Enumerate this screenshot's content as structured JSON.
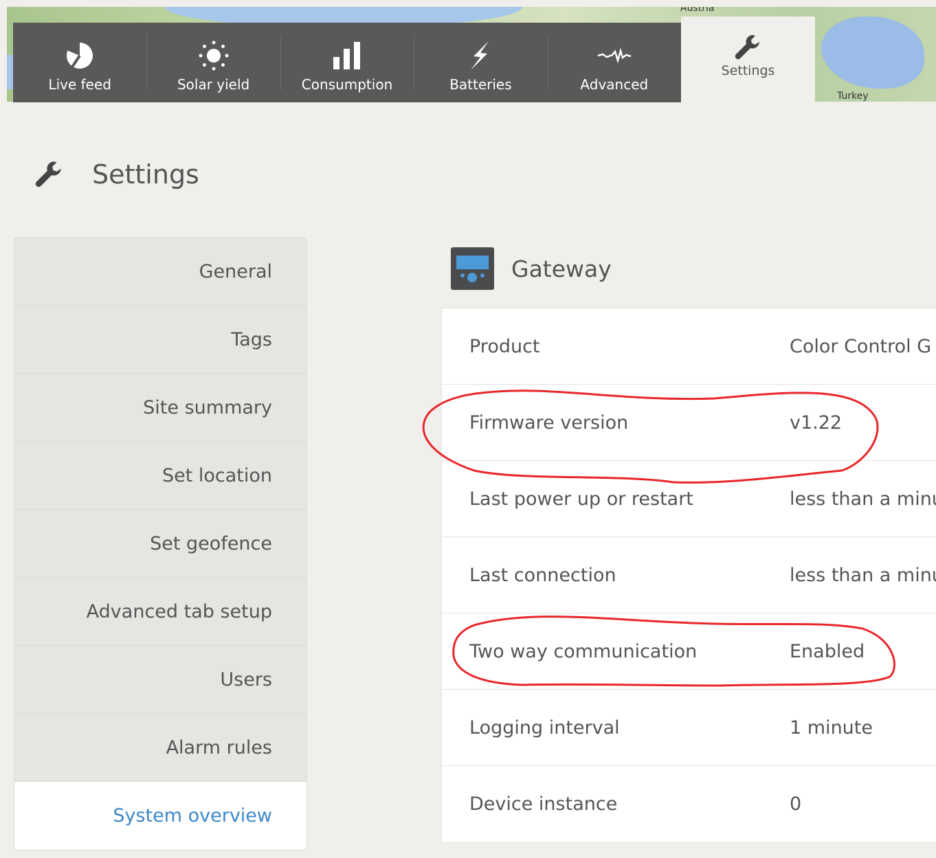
{
  "map": {
    "labels": {
      "austria": "Austria",
      "turkey": "Turkey"
    }
  },
  "nav": {
    "tabs": [
      {
        "label": "Live feed",
        "icon": "pie-chart-icon"
      },
      {
        "label": "Solar yield",
        "icon": "sun-icon"
      },
      {
        "label": "Consumption",
        "icon": "bar-chart-icon"
      },
      {
        "label": "Batteries",
        "icon": "lightning-icon"
      },
      {
        "label": "Advanced",
        "icon": "waveform-icon"
      }
    ],
    "settings_tab": {
      "label": "Settings",
      "icon": "wrench-icon"
    }
  },
  "page": {
    "title": "Settings",
    "icon": "wrench-icon"
  },
  "sidebar": {
    "items": [
      {
        "label": "General"
      },
      {
        "label": "Tags"
      },
      {
        "label": "Site summary"
      },
      {
        "label": "Set location"
      },
      {
        "label": "Set geofence"
      },
      {
        "label": "Advanced tab setup"
      },
      {
        "label": "Users"
      },
      {
        "label": "Alarm rules"
      },
      {
        "label": "System overview",
        "active": true
      }
    ]
  },
  "gateway": {
    "title": "Gateway",
    "icon": "device-icon",
    "rows": [
      {
        "key": "Product",
        "value": "Color Control G"
      },
      {
        "key": "Firmware version",
        "value": "v1.22"
      },
      {
        "key": "Last power up or restart",
        "value": "less than a minu"
      },
      {
        "key": "Last connection",
        "value": "less than a minu"
      },
      {
        "key": "Two way communication",
        "value": "Enabled"
      },
      {
        "key": "Logging interval",
        "value": "1 minute"
      },
      {
        "key": "Device instance",
        "value": "0"
      }
    ]
  },
  "colors": {
    "nav_bg": "#5a5957",
    "accent": "#3d88c8",
    "annotation": "#e8262b"
  }
}
